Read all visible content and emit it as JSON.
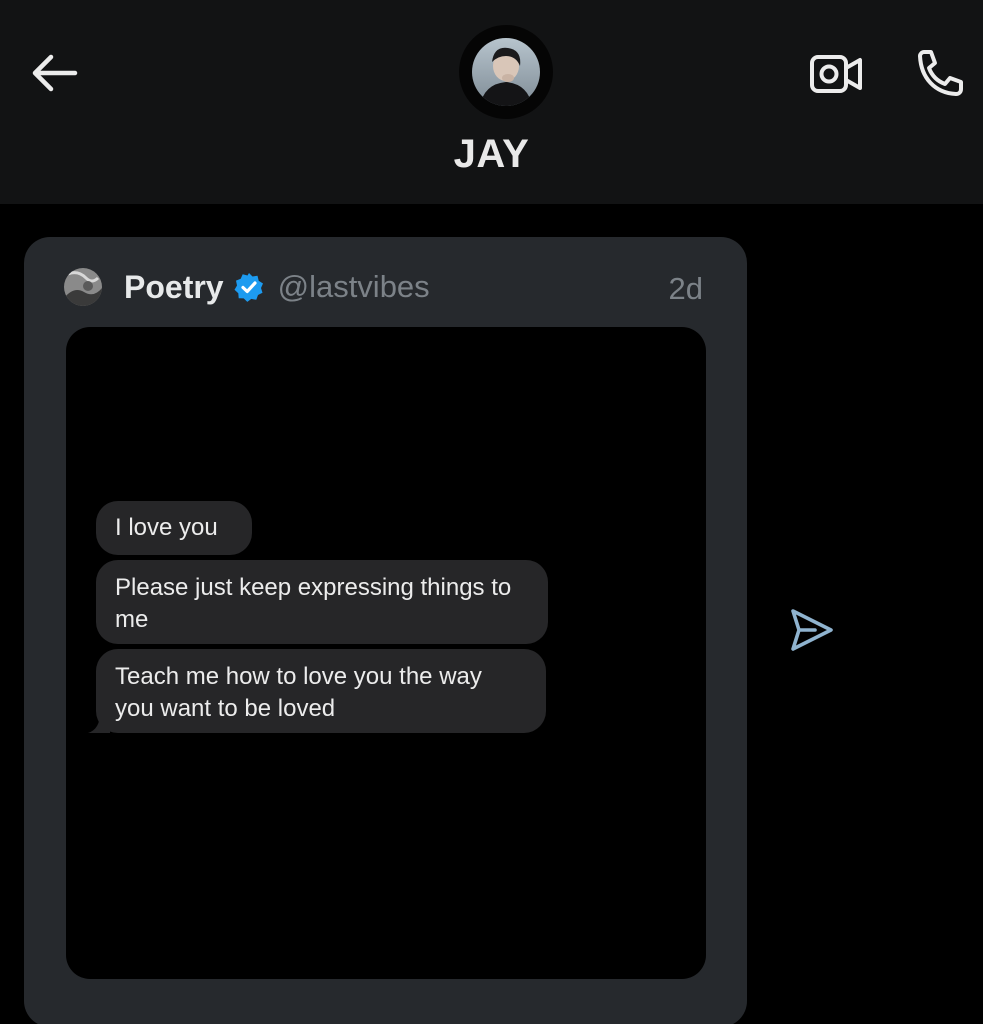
{
  "header": {
    "contact_name": "JAY"
  },
  "tweet": {
    "author_name": "Poetry",
    "author_handle": "@lastvibes",
    "time": "2d",
    "messages": [
      {
        "text": "I love you"
      },
      {
        "text": "Please just keep expressing things to me"
      },
      {
        "text": "Teach me how to love you the way you want to be loved"
      }
    ]
  },
  "icons": {
    "back": "arrow-left-icon",
    "video": "video-camera-icon",
    "call": "phone-icon",
    "verified": "verified-badge-icon",
    "share": "send-icon"
  },
  "colors": {
    "background": "#000000",
    "header_bg": "#121314",
    "card_bg": "#26292d",
    "bubble_bg": "#262628",
    "verified": "#1d9bf0",
    "share_icon": "#8fb3cf"
  }
}
